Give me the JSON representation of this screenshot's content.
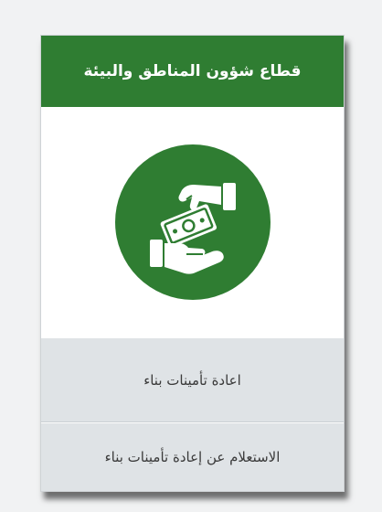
{
  "card": {
    "title": "قطاع شؤون المناطق والبيئة",
    "icon": "money-exchange-hands-icon",
    "actions": [
      {
        "label": "اعادة تأمينات بناء"
      },
      {
        "label": "الاستعلام عن إعادة تأمينات بناء"
      }
    ]
  },
  "colors": {
    "header_green": "#2f7d32",
    "icon_circle_green": "#2f7d32",
    "action_bg": "#dfe3e6"
  }
}
